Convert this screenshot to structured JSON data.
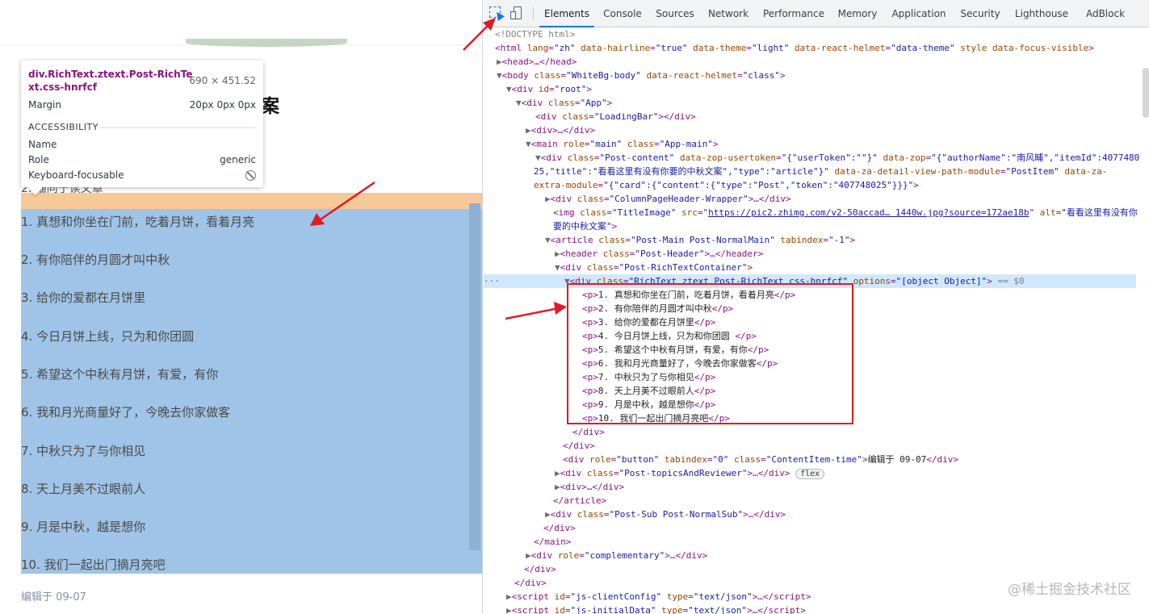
{
  "page": {
    "heading_fragment": "文案",
    "partial_line": "2. 猫同于读文章",
    "paragraphs": [
      "1. 真想和你坐在门前，吃着月饼，看着月亮",
      "2. 有你陪伴的月圆才叫中秋",
      "3. 给你的爱都在月饼里",
      "4. 今日月饼上线，只为和你团圆",
      "5. 希望这个中秋有月饼，有爱，有你",
      "6. 我和月光商量好了，今晚去你家做客",
      "7. 中秋只为了与你相见",
      "8. 天上月美不过眼前人",
      "9. 月是中秋，越是想你",
      "10. 我们一起出门摘月亮吧"
    ],
    "edit_time": "编辑于 09-07",
    "content_highlight_color": "#9fc4e7",
    "margin_highlight_color": "#f7c898"
  },
  "tooltip": {
    "selector": "div.RichText.ztext.Post-RichText.css-hnrfcf",
    "size": "690 × 451.52",
    "margin_label": "Margin",
    "margin_value": "20px 0px 0px",
    "accessibility_title": "ACCESSIBILITY",
    "name_label": "Name",
    "name_value": "",
    "role_label": "Role",
    "role_value": "generic",
    "focusable_label": "Keyboard-focusable",
    "focusable_icon": "not-allowed-icon"
  },
  "devtools": {
    "tabs": [
      "Elements",
      "Console",
      "Sources",
      "Network",
      "Performance",
      "Memory",
      "Application",
      "Security",
      "Lighthouse",
      "AdBlock"
    ],
    "active_tab": "Elements",
    "dots": "···",
    "dom": {
      "doctype": "<!DOCTYPE html>",
      "l1": {
        "t": "<html ",
        "a": [
          [
            "lang",
            "\"zh\""
          ],
          [
            "data-hairline",
            "\"true\""
          ],
          [
            "data-theme",
            "\"light\""
          ],
          [
            "data-react-helmet",
            "\"data-theme\""
          ],
          [
            "style",
            ""
          ],
          [
            "data-focus-visible",
            ""
          ]
        ],
        "e": ">"
      },
      "head": "<head>…</head>",
      "body_open": "<body ",
      "body_class_n": "class",
      "body_class_v": "\"WhiteBg-body\"",
      "body_helmet_n": "data-react-helmet",
      "body_helmet_v": "\"class\"",
      "root_id_v": "\"root\"",
      "app_v": "\"App\"",
      "loading_v": "\"LoadingBar\"",
      "div_collapsed": "<div>…</div>",
      "main_role_v": "\"main\"",
      "main_class_v": "\"App-main\"",
      "post_content_v": "\"Post-content\"",
      "usertoken_n": "data-zop-usertoken",
      "usertoken_v": "\"{\"userToken\":\"\"}\"",
      "zop_n": "data-zop",
      "zop_v1": "\"{\"authorName\":\"南风晡\",\"itemId\":4077480",
      "zop_v2": "25,\"title\":\"看看这里有没有你要的中秋文案\",\"type\":\"article\"}\"",
      "za_path_n": "data-za-detail-view-path-module",
      "za_path_v": "\"PostItem\"",
      "za_extra_n": "data-za-",
      "za_extra_n2": "extra-module",
      "za_extra_v": "\"{\"card\":{\"content\":{\"type\":\"Post\",\"token\":\"407748025\"}}}\"",
      "col_header_v": "\"ColumnPageHeader-Wrapper\"",
      "img_class_v": "\"TitleImage\"",
      "img_src_v": "https://pic2.zhimg.com/v2-50accad… 1440w.jpg?source=172ae18b",
      "img_alt_v1": "\"看看这里有没有你",
      "img_alt_v2": "要的中秋文案\"",
      "article_class_v": "\"Post-Main Post-NormalMain\"",
      "tabindex_v": "\"-1\"",
      "header_class_v": "\"Post-Header\"",
      "richcontainer_v": "\"Post-RichTextContainer\"",
      "rich_class_v": "\"RichText ztext Post-RichText css-hnrfcf\"",
      "options_n": "options",
      "options_v": "\"[object Object]\"",
      "selected_suffix": " == $0",
      "p_items": [
        "1. 真想和你坐在门前，吃着月饼，看着月亮",
        "2. 有你陪伴的月圆才叫中秋",
        "3. 给你的爱都在月饼里",
        "4. 今日月饼上线，只为和你团圆 ",
        "5. 希望这个中秋有月饼，有爱，有你",
        "6. 我和月光商量好了，今晚去你家做客",
        "7. 中秋只为了与你相见",
        "8. 天上月美不过眼前人",
        "9. 月是中秋，越是想你",
        "10. 我们一起出门摘月亮吧"
      ],
      "div_close": "</div>",
      "btn_role_v": "\"button\"",
      "btn_tab_v": "\"0\"",
      "btn_class_v": "\"ContentItem-time\"",
      "btn_text": "编辑于 09-07",
      "topics_v": "\"Post-topicsAndReviewer\"",
      "flex_badge": "flex",
      "article_close": "</article>",
      "sub_v": "\"Post-Sub Post-NormalSub\"",
      "main_close": "</main>",
      "complementary_v": "\"complementary\"",
      "client_cfg_id": "\"js-clientConfig\"",
      "json_type": "\"text/json\"",
      "init_data_id": "\"js-initialData\""
    }
  },
  "watermark": "@稀土掘金技术社区",
  "colors": {
    "annotation_red": "#e01b24",
    "selected_row": "#cfe8fc",
    "accent": "#1a73e8"
  }
}
